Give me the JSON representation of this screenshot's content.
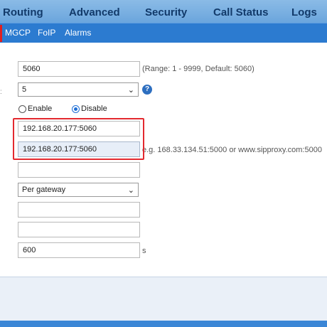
{
  "top_nav": {
    "items": [
      "Routing",
      "Advanced",
      "Security",
      "Call Status",
      "Logs"
    ]
  },
  "sub_nav": {
    "items": [
      "MGCP",
      "FoIP",
      "Alarms"
    ]
  },
  "form": {
    "port_value": "5060",
    "port_hint": "(Range: 1 - 9999, Default: 5060)",
    "select_value": "5",
    "help_glyph": "?",
    "radio_enable": "Enable",
    "radio_disable": "Disable",
    "radio_selected": "Disable",
    "proxy_primary": "192.168.20.177:5060",
    "proxy_secondary": "192.168.20.177:5060",
    "proxy_hint": "e.g. 168.33.134.51:5000 or www.sipproxy.com:5000",
    "empty_field_1": "",
    "gateway_mode": "Per gateway",
    "empty_field_2": "",
    "empty_field_3": "",
    "timer_value": "600",
    "timer_unit": "s"
  },
  "left_edge_mark": ":"
}
